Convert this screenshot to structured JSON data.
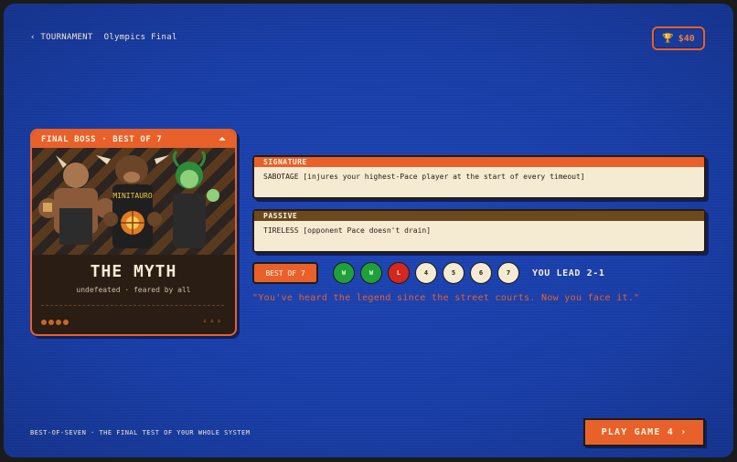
{
  "nav": {
    "back_label": "‹ TOURNAMENT",
    "event": "Olympics Final"
  },
  "wallet": {
    "amount": "$40",
    "icon": "trophy-icon"
  },
  "boss_card": {
    "header": "FINAL BOSS · BEST OF 7",
    "name": "THE MYTH",
    "subtitle": "undefeated · feared by all",
    "jersey_text": "MINITAURO",
    "foot_marks": "▵▵▵"
  },
  "signature": {
    "label": "SIGNATURE",
    "text": "SABOTAGE [injures your highest-Pace player at the start of every timeout]"
  },
  "passive": {
    "label": "PASSIVE",
    "text": "TIRELESS [opponent Pace doesn't drain]"
  },
  "series": {
    "badge": "BEST OF 7",
    "games": [
      "W",
      "W",
      "L",
      "4",
      "5",
      "6",
      "7"
    ],
    "status": "YOU LEAD 2-1"
  },
  "quote": "\"You've heard the legend since the street courts. Now you face it.\"",
  "footer": "BEST-OF-SEVEN · THE FINAL TEST OF Y0UR WHOLE SYSTEM",
  "play_button": "PLAY GAME 4 ›",
  "colors": {
    "accent": "#e8612a",
    "background": "#1a3fa8",
    "win": "#1fa03a",
    "loss": "#d4271e",
    "paper": "#f5ead2"
  }
}
